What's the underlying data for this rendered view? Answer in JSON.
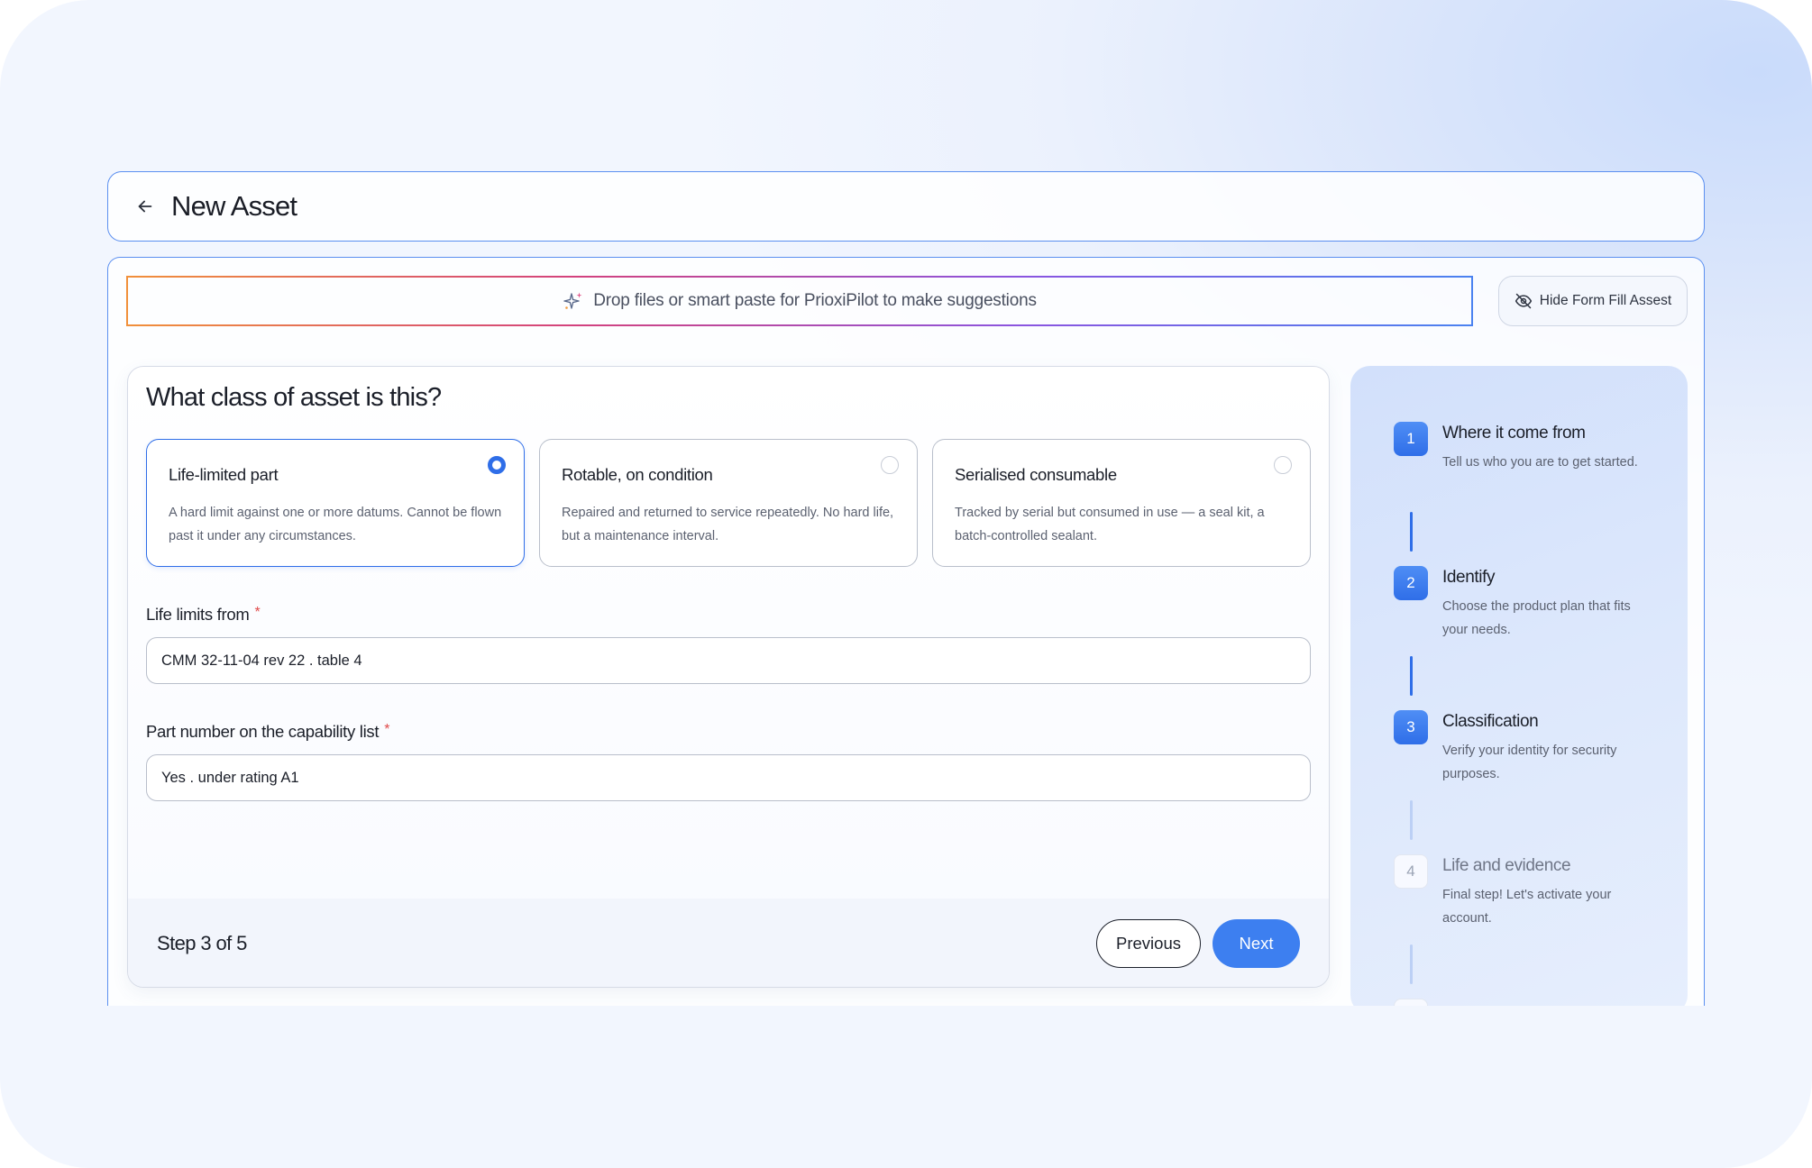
{
  "header": {
    "title": "New Asset"
  },
  "dropzone": {
    "text": "Drop files or smart paste for PrioxiPilot to make suggestions"
  },
  "hide_button": {
    "label": "Hide Form Fill Assest"
  },
  "form": {
    "question": "What class of asset is this?",
    "options": [
      {
        "title": "Life-limited part",
        "description": "A hard limit against one or more datums. Cannot be flown past it under any circumstances.",
        "selected": true
      },
      {
        "title": "Rotable, on condition",
        "description": "Repaired and returned to service repeatedly. No hard life, but a maintenance interval.",
        "selected": false
      },
      {
        "title": "Serialised consumable",
        "description": "Tracked by serial but consumed in use — a seal kit, a batch-controlled sealant.",
        "selected": false
      }
    ],
    "fields": [
      {
        "label": "Life limits from",
        "required_mark": "*",
        "value": "CMM 32-11-04 rev 22 . table 4"
      },
      {
        "label": "Part number on the capability list",
        "required_mark": "*",
        "value": "Yes . under rating A1"
      }
    ],
    "footer": {
      "step_text": "Step 3 of 5",
      "previous_label": "Previous",
      "next_label": "Next"
    }
  },
  "stepper": {
    "steps": [
      {
        "number": "1",
        "title": "Where it come from",
        "description": "Tell us who you are to get started.",
        "status": "done"
      },
      {
        "number": "2",
        "title": "Identify",
        "description": "Choose the product plan that fits your needs.",
        "status": "done"
      },
      {
        "number": "3",
        "title": "Classification",
        "description": "Verify your identity for security purposes.",
        "status": "current"
      },
      {
        "number": "4",
        "title": "Life and evidence",
        "description": "Final step! Let's activate your account.",
        "status": "upcoming"
      }
    ]
  },
  "colors": {
    "accent": "#2f6ee8",
    "button_primary": "#3d7ff0",
    "required": "#e04b4b",
    "border_active": "#5b8ff0"
  }
}
